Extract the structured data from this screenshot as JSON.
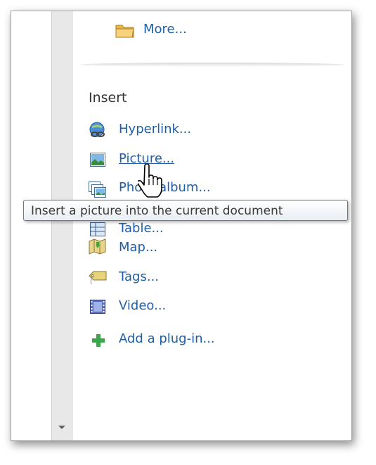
{
  "top_links": {
    "more": "More..."
  },
  "insert": {
    "title": "Insert",
    "items": [
      {
        "label": "Hyperlink...",
        "icon": "hyperlink-icon"
      },
      {
        "label": "Picture...",
        "icon": "picture-icon"
      },
      {
        "label": "Photo album...",
        "icon": "photo-album-icon"
      },
      {
        "label": "Table...",
        "icon": "table-icon"
      },
      {
        "label": "Map...",
        "icon": "map-icon"
      },
      {
        "label": "Tags...",
        "icon": "tags-icon"
      },
      {
        "label": "Video...",
        "icon": "video-icon"
      }
    ],
    "add_plugin": "Add a plug-in..."
  },
  "tooltip": {
    "text": "Insert a picture into the current document"
  },
  "colors": {
    "link": "#1e5fa8",
    "section_title": "#333333"
  }
}
